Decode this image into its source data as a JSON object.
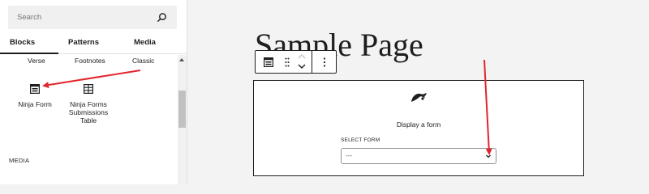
{
  "sidebar": {
    "search": {
      "placeholder": "Search",
      "icon": "search-icon"
    },
    "tabs": [
      {
        "label": "Blocks",
        "active": true
      },
      {
        "label": "Patterns",
        "active": false
      },
      {
        "label": "Media",
        "active": false
      }
    ],
    "row_labels": [
      "Verse",
      "Footnotes",
      "Classic"
    ],
    "blocks": [
      {
        "label": "Ninja Form",
        "icon": "form-icon"
      },
      {
        "label": "Ninja Forms Submissions Table",
        "icon": "table-icon"
      }
    ],
    "section_heading": "MEDIA"
  },
  "editor": {
    "page_title": "Sample Page",
    "toolbar": {
      "block_icon": "form-icon",
      "drag_icon": "drag-handle-icon",
      "move_icons": [
        "chevron-up-icon",
        "chevron-down-icon"
      ],
      "more_icon": "more-vertical-icon"
    },
    "form_block": {
      "icon": "ninja-forms-icon",
      "description": "Display a form",
      "select_label": "SELECT FORM",
      "select_value": "---"
    }
  },
  "annotations": {
    "arrow_color": "#e0262b"
  },
  "colors": {
    "text": "#1e1e1e",
    "canvas_bg": "#f3f3f3",
    "search_bg": "#f0f0f0"
  }
}
